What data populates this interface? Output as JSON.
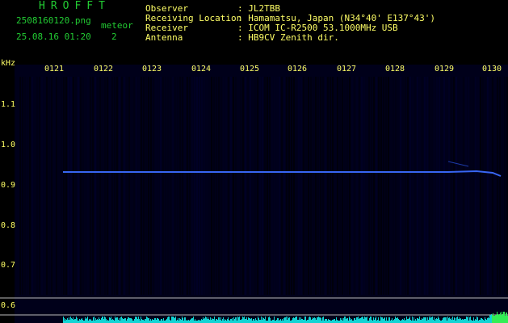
{
  "header": {
    "app_title": "HROFFT",
    "file_name": "2508160120.png",
    "datetime": "25.08.16 01:20",
    "meteor_label": "meteor",
    "meteor_count": "2",
    "info_labels": [
      "Observer",
      "Receiving Location",
      "Receiver",
      "Antenna"
    ],
    "info_values": [
      ": JL2TBB",
      ": Hamamatsu, Japan (N34°40' E137°43')",
      ": ICOM IC-R2500 53.1000MHz USB",
      ": HB9CV Zenith dir."
    ]
  },
  "plot": {
    "y_unit": "kHz",
    "time_ticks": [
      "0121",
      "0122",
      "0123",
      "0124",
      "0125",
      "0126",
      "0127",
      "0128",
      "0129",
      "0130"
    ],
    "freq_ticks": [
      "1.1",
      "1.0",
      "0.9",
      "0.8",
      "0.7",
      "0.6"
    ],
    "colors": {
      "background": "#00001a",
      "trace": "#3b6cff",
      "grid_line": "#ffffff",
      "level_bar": "#11d4d4"
    }
  }
}
